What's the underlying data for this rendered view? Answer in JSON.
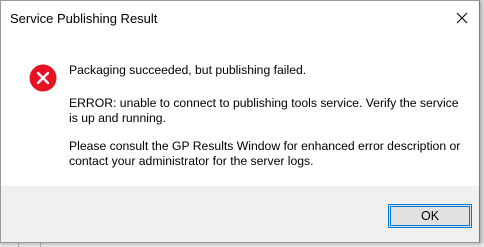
{
  "window": {
    "title": "Service Publishing Result",
    "close_icon": "close-icon"
  },
  "message": {
    "icon": "error-icon",
    "icon_color": "#e81123",
    "line1": "Packaging succeeded, but publishing failed.",
    "line2": "ERROR: unable to connect to publishing tools service. Verify the service is up and running.",
    "line3": "Please consult the GP Results Window for enhanced error description or contact your administrator for the server logs."
  },
  "buttons": {
    "ok_label": "OK",
    "accent": "#0078d7"
  }
}
